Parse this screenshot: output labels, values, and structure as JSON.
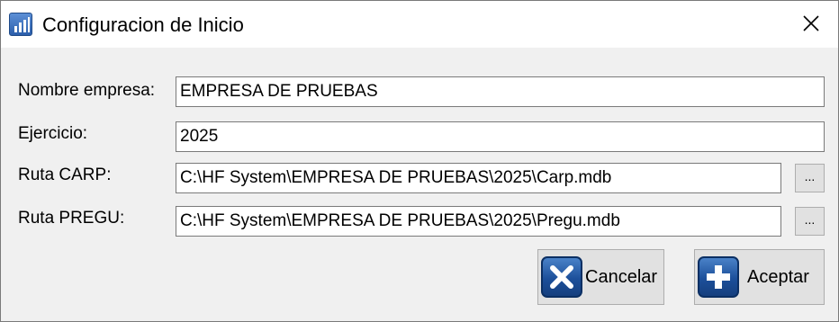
{
  "window": {
    "title": "Configuracion de Inicio",
    "icon": "bar-chart-icon"
  },
  "form": {
    "fields": [
      {
        "label": "Nombre empresa:",
        "value": "EMPRESA DE PRUEBAS"
      },
      {
        "label": "Ejercicio:",
        "value": "2025"
      },
      {
        "label": "Ruta CARP:",
        "value": "C:\\HF System\\EMPRESA DE PRUEBAS\\2025\\Carp.mdb",
        "browse_label": "..."
      },
      {
        "label": "Ruta PREGU:",
        "value": "C:\\HF System\\EMPRESA DE PRUEBAS\\2025\\Pregu.mdb",
        "browse_label": "..."
      }
    ]
  },
  "buttons": {
    "cancel_label": "Cancelar",
    "cancel_icon": "x-icon",
    "accept_label": "Aceptar",
    "accept_icon": "plus-icon"
  },
  "colors": {
    "dialog_bg": "#f0f0f0",
    "titlebar_bg": "#ffffff",
    "icon_blue": "#1c4f9a"
  }
}
